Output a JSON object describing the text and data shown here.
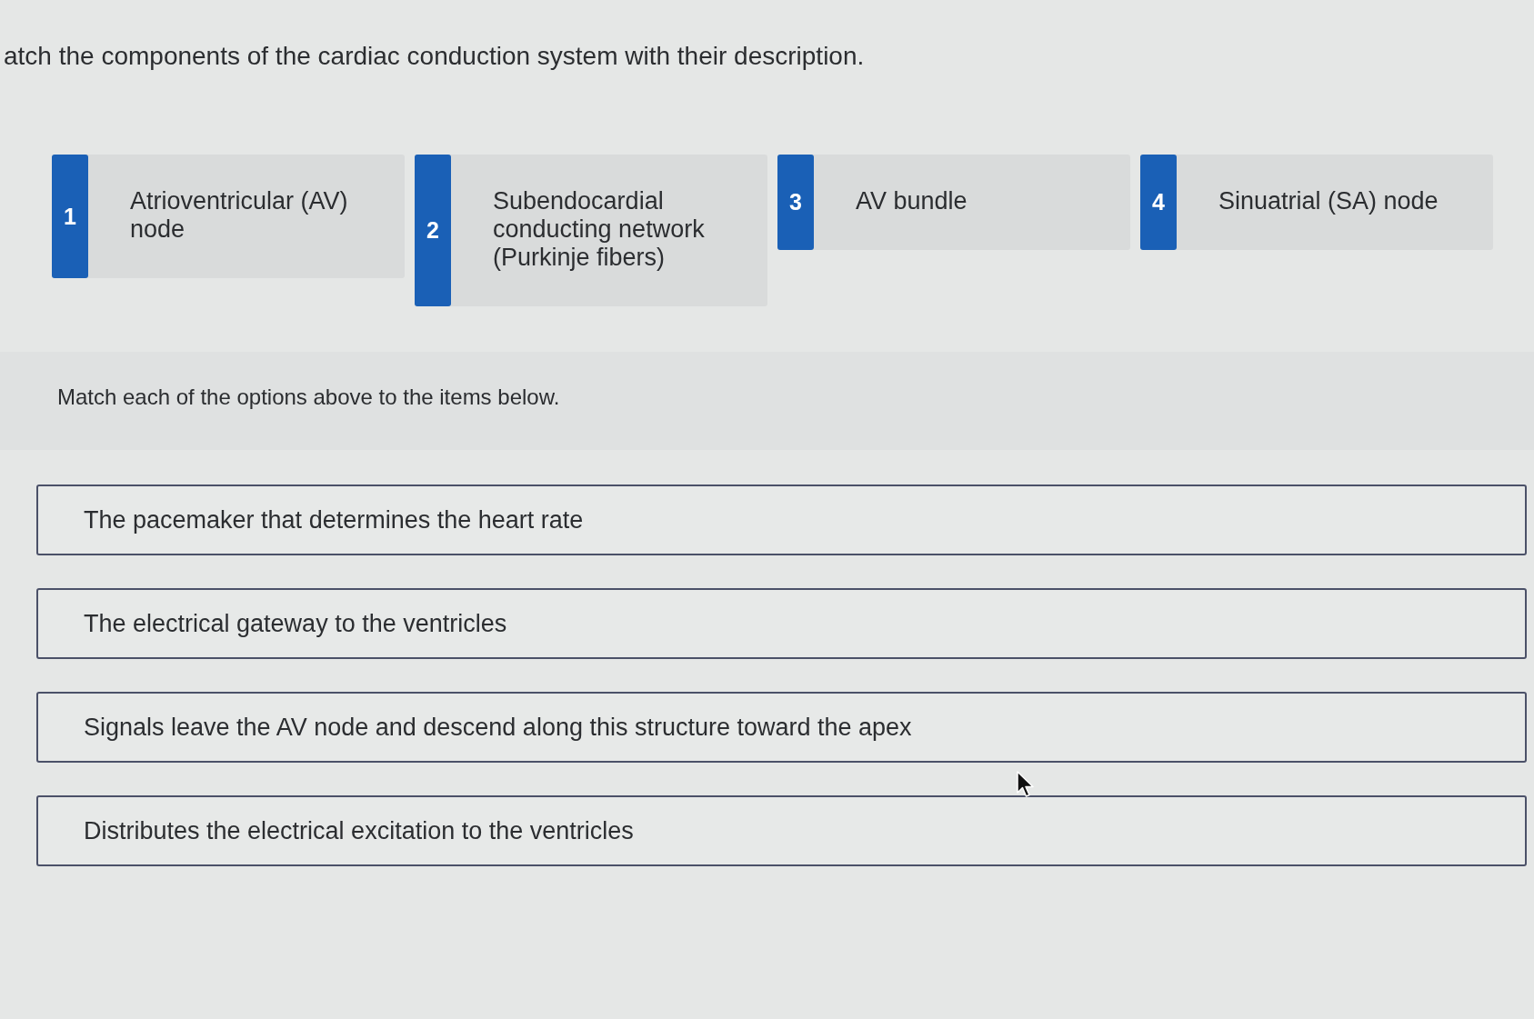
{
  "instruction": "atch the components of the cardiac conduction system with their description.",
  "options": [
    {
      "number": "1",
      "label": "Atrioventricular (AV) node"
    },
    {
      "number": "2",
      "label": "Subendocardial conducting network (Purkinje fibers)"
    },
    {
      "number": "3",
      "label": "AV bundle"
    },
    {
      "number": "4",
      "label": "Sinuatrial (SA) node"
    }
  ],
  "prompt": "Match each of the options above to the items below.",
  "items": [
    {
      "text": "The pacemaker that determines the heart rate"
    },
    {
      "text": "The electrical gateway to the ventricles"
    },
    {
      "text": "Signals leave the AV node and descend along this structure toward the apex"
    },
    {
      "text": "Distributes the electrical excitation to the ventricles"
    }
  ]
}
